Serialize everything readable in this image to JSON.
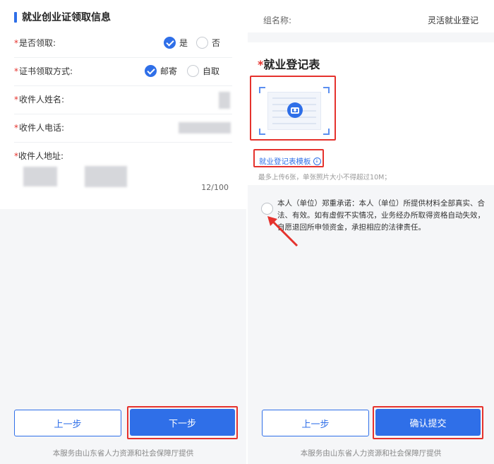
{
  "left": {
    "section_title": "就业创业证领取信息",
    "fields": {
      "receive": {
        "label": "是否领取:",
        "options": [
          "是",
          "否"
        ],
        "selected": "是"
      },
      "method": {
        "label": "证书领取方式:",
        "options": [
          "邮寄",
          "自取"
        ],
        "selected": "邮寄"
      },
      "name": {
        "label": "收件人姓名:"
      },
      "phone": {
        "label": "收件人电话:"
      },
      "address": {
        "label": "收件人地址:",
        "counter": "12/100"
      }
    },
    "buttons": {
      "prev": "上一步",
      "next": "下一步"
    },
    "footer": "本服务由山东省人力资源和社会保障厅提供"
  },
  "right": {
    "group": {
      "label": "组名称:",
      "value": "灵活就业登记"
    },
    "form_title": "就业登记表",
    "template_link": "就业登记表模板",
    "upload_hint": "最多上传6张，单张照片大小不得超过10M；",
    "pledge": "本人（单位）郑重承诺：本人（单位）所提供材料全部真实、合法、有效。如有虚假不实情况，业务经办所取得资格自动失效，自愿退回所申领资金，承担相应的法律责任。",
    "buttons": {
      "prev": "上一步",
      "submit": "确认提交"
    },
    "footer": "本服务由山东省人力资源和社会保障厅提供"
  },
  "colors": {
    "primary": "#2f6fe8",
    "highlight": "#e5322d",
    "required": "#e5322d"
  },
  "icons": [
    "check-circle-icon",
    "radio-empty-icon",
    "camera-icon",
    "download-icon",
    "arrow-annotation"
  ]
}
